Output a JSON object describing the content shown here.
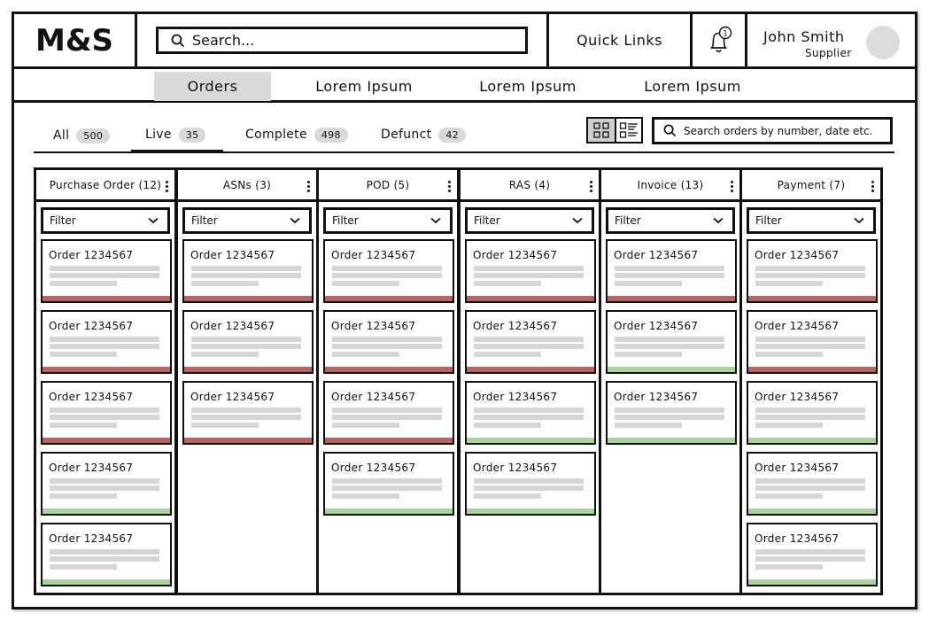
{
  "header": {
    "logo": "M&S",
    "search_placeholder": "Search...",
    "quick_links": "Quick Links",
    "notification_count": "1",
    "user_name": "John Smith",
    "user_role": "Supplier"
  },
  "nav": {
    "items": [
      "Orders",
      "Lorem Ipsum",
      "Lorem Ipsum",
      "Lorem Ipsum"
    ],
    "active": 0
  },
  "status_tabs": [
    {
      "label": "All",
      "count": "500"
    },
    {
      "label": "Live",
      "count": "35"
    },
    {
      "label": "Complete",
      "count": "498"
    },
    {
      "label": "Defunct",
      "count": "42"
    }
  ],
  "order_search_placeholder": "Search orders by number, date etc.",
  "colors": {
    "red": "#b5645e",
    "green": "#a8d49a"
  },
  "columns": [
    {
      "title": "Purchase Order (12)",
      "filter": "Filter",
      "cards": [
        {
          "title": "Order 1234567",
          "status": "red"
        },
        {
          "title": "Order 1234567",
          "status": "red"
        },
        {
          "title": "Order 1234567",
          "status": "red"
        },
        {
          "title": "Order 1234567",
          "status": "green"
        },
        {
          "title": "Order 1234567",
          "status": "green"
        }
      ]
    },
    {
      "title": "ASNs (3)",
      "filter": "Filter",
      "cards": [
        {
          "title": "Order 1234567",
          "status": "red"
        },
        {
          "title": "Order 1234567",
          "status": "red"
        },
        {
          "title": "Order 1234567",
          "status": "red"
        }
      ]
    },
    {
      "title": "POD (5)",
      "filter": "Filter",
      "cards": [
        {
          "title": "Order 1234567",
          "status": "red"
        },
        {
          "title": "Order 1234567",
          "status": "red"
        },
        {
          "title": "Order 1234567",
          "status": "red"
        },
        {
          "title": "Order 1234567",
          "status": "green"
        }
      ]
    },
    {
      "title": "RAS (4)",
      "filter": "Filter",
      "cards": [
        {
          "title": "Order 1234567",
          "status": "red"
        },
        {
          "title": "Order 1234567",
          "status": "red"
        },
        {
          "title": "Order 1234567",
          "status": "green"
        },
        {
          "title": "Order 1234567",
          "status": "green"
        }
      ]
    },
    {
      "title": "Invoice (13)",
      "filter": "Filter",
      "cards": [
        {
          "title": "Order 1234567",
          "status": "red"
        },
        {
          "title": "Order 1234567",
          "status": "green"
        },
        {
          "title": "Order 1234567",
          "status": "green"
        }
      ]
    },
    {
      "title": "Payment (7)",
      "filter": "Filter",
      "cards": [
        {
          "title": "Order 1234567",
          "status": "red"
        },
        {
          "title": "Order 1234567",
          "status": "red"
        },
        {
          "title": "Order 1234567",
          "status": "green"
        },
        {
          "title": "Order 1234567",
          "status": "green"
        },
        {
          "title": "Order 1234567",
          "status": "green"
        }
      ]
    }
  ]
}
